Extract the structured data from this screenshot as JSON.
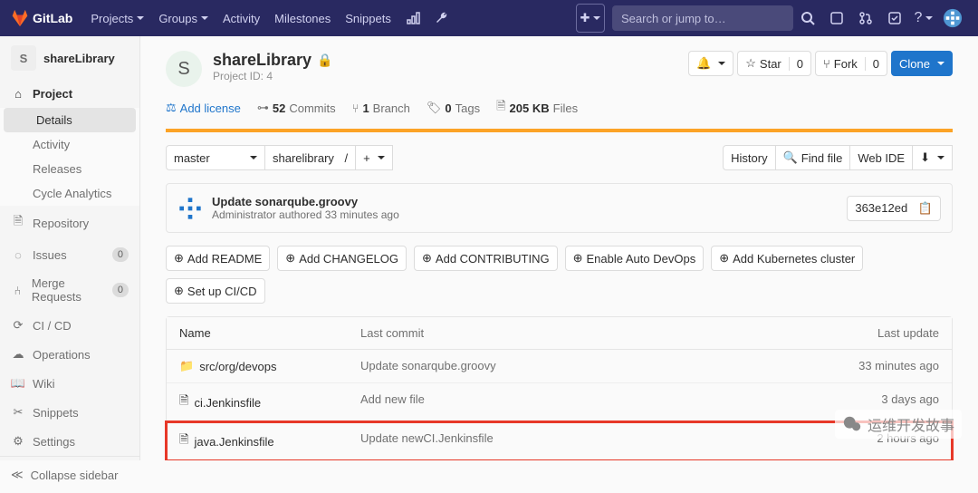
{
  "brand": "GitLab",
  "topnav": [
    "Projects",
    "Groups",
    "Activity",
    "Milestones",
    "Snippets"
  ],
  "search_placeholder": "Search or jump to…",
  "context": {
    "initial": "S",
    "name": "shareLibrary"
  },
  "sidebar": {
    "project": "Project",
    "sub": [
      "Details",
      "Activity",
      "Releases",
      "Cycle Analytics"
    ],
    "items": [
      {
        "icon": "repo",
        "label": "Repository"
      },
      {
        "icon": "issues",
        "label": "Issues",
        "badge": "0"
      },
      {
        "icon": "mr",
        "label": "Merge Requests",
        "badge": "0"
      },
      {
        "icon": "cicd",
        "label": "CI / CD"
      },
      {
        "icon": "ops",
        "label": "Operations"
      },
      {
        "icon": "wiki",
        "label": "Wiki"
      },
      {
        "icon": "snip",
        "label": "Snippets"
      },
      {
        "icon": "set",
        "label": "Settings"
      }
    ],
    "collapse": "Collapse sidebar"
  },
  "project": {
    "initial": "S",
    "name": "shareLibrary",
    "idlabel": "Project ID: 4",
    "notify": "☆",
    "star_label": "Star",
    "star_count": "0",
    "fork_label": "Fork",
    "fork_count": "0",
    "clone": "Clone"
  },
  "stats": {
    "addlic": "Add license",
    "commits_n": "52",
    "commits": "Commits",
    "branch_n": "1",
    "branch": "Branch",
    "tags_n": "0",
    "tags": "Tags",
    "size_n": "205 KB",
    "size": "Files"
  },
  "branch": {
    "name": "master",
    "crumb": "sharelibrary",
    "sep": "/",
    "history": "History",
    "find": "Find file",
    "ide": "Web IDE"
  },
  "lastcommit": {
    "msg": "Update sonarqube.groovy",
    "meta": "Administrator authored 33 minutes ago",
    "sha": "363e12ed"
  },
  "suggest": [
    "Add README",
    "Add CHANGELOG",
    "Add CONTRIBUTING",
    "Enable Auto DevOps",
    "Add Kubernetes cluster",
    "Set up CI/CD"
  ],
  "table": {
    "cols": [
      "Name",
      "Last commit",
      "Last update"
    ],
    "rows": [
      {
        "icon": "folder",
        "name": "src/org/devops",
        "commit": "Update sonarqube.groovy",
        "time": "33 minutes ago"
      },
      {
        "icon": "file",
        "name": "ci.Jenkinsfile",
        "commit": "Add new file",
        "time": "3 days ago"
      },
      {
        "icon": "file",
        "name": "java.Jenkinsfile",
        "commit": "Update newCI.Jenkinsfile",
        "time": "2 hours ago",
        "hl": true
      }
    ]
  },
  "watermark": "运维开发故事"
}
